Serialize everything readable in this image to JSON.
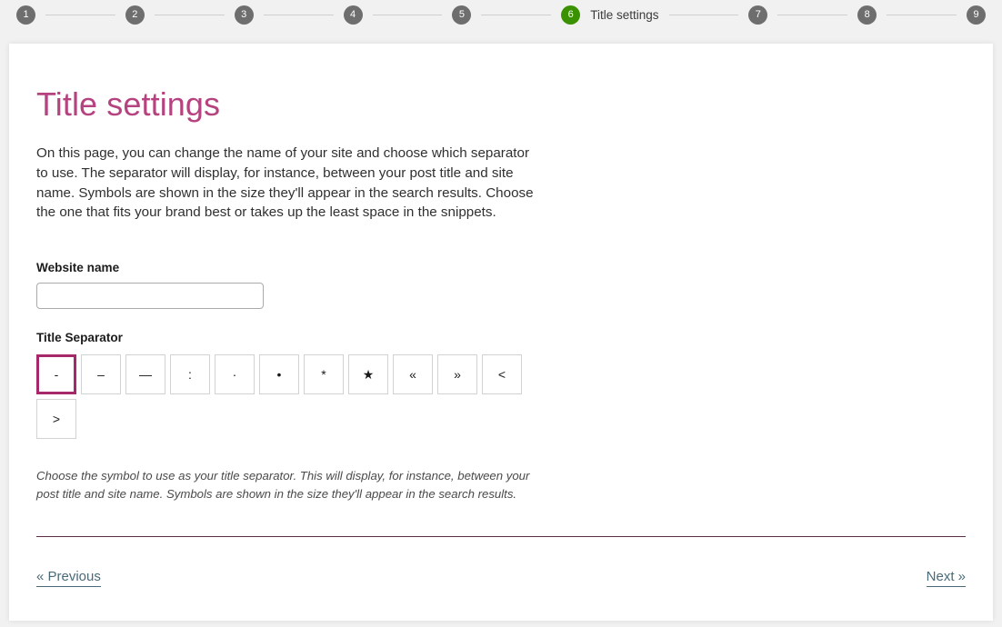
{
  "stepbar": {
    "steps": [
      {
        "number": "1",
        "label": "",
        "active": false
      },
      {
        "number": "2",
        "label": "",
        "active": false
      },
      {
        "number": "3",
        "label": "",
        "active": false
      },
      {
        "number": "4",
        "label": "",
        "active": false
      },
      {
        "number": "5",
        "label": "",
        "active": false
      },
      {
        "number": "6",
        "label": "Title settings",
        "active": true
      },
      {
        "number": "7",
        "label": "",
        "active": false
      },
      {
        "number": "8",
        "label": "",
        "active": false
      },
      {
        "number": "9",
        "label": "",
        "active": false
      }
    ],
    "active_color": "#3a9200",
    "inactive_color": "#6e6e6e"
  },
  "page": {
    "title": "Title settings",
    "title_color": "#b5437f",
    "intro": "On this page, you can change the name of your site and choose which separator to use. The separator will display, for instance, between your post title and site name. Symbols are shown in the size they'll appear in the search results. Choose the one that fits your brand best or takes up the least space in the snippets."
  },
  "website_name": {
    "label": "Website name",
    "value": "",
    "placeholder": ""
  },
  "title_separator": {
    "label": "Title Separator",
    "selected_index": 0,
    "selected_border_color": "#a4286a",
    "options": [
      {
        "symbol": "-",
        "name": "hyphen"
      },
      {
        "symbol": "–",
        "name": "en-dash"
      },
      {
        "symbol": "—",
        "name": "em-dash"
      },
      {
        "symbol": ":",
        "name": "colon"
      },
      {
        "symbol": "·",
        "name": "middle-dot"
      },
      {
        "symbol": "•",
        "name": "bullet"
      },
      {
        "symbol": "*",
        "name": "asterisk"
      },
      {
        "symbol": "★",
        "name": "star"
      },
      {
        "symbol": "«",
        "name": "double-left-angle"
      },
      {
        "symbol": "»",
        "name": "double-right-angle"
      },
      {
        "symbol": "<",
        "name": "less-than"
      },
      {
        "symbol": ">",
        "name": "greater-than"
      }
    ],
    "help_text": "Choose the symbol to use as your title separator. This will display, for instance, between your post title and site name. Symbols are shown in the size they'll appear in the search results."
  },
  "footer": {
    "previous_label": "« Previous",
    "next_label": "Next »",
    "link_color": "#4a6a78",
    "divider_color": "#5c2c4b"
  }
}
